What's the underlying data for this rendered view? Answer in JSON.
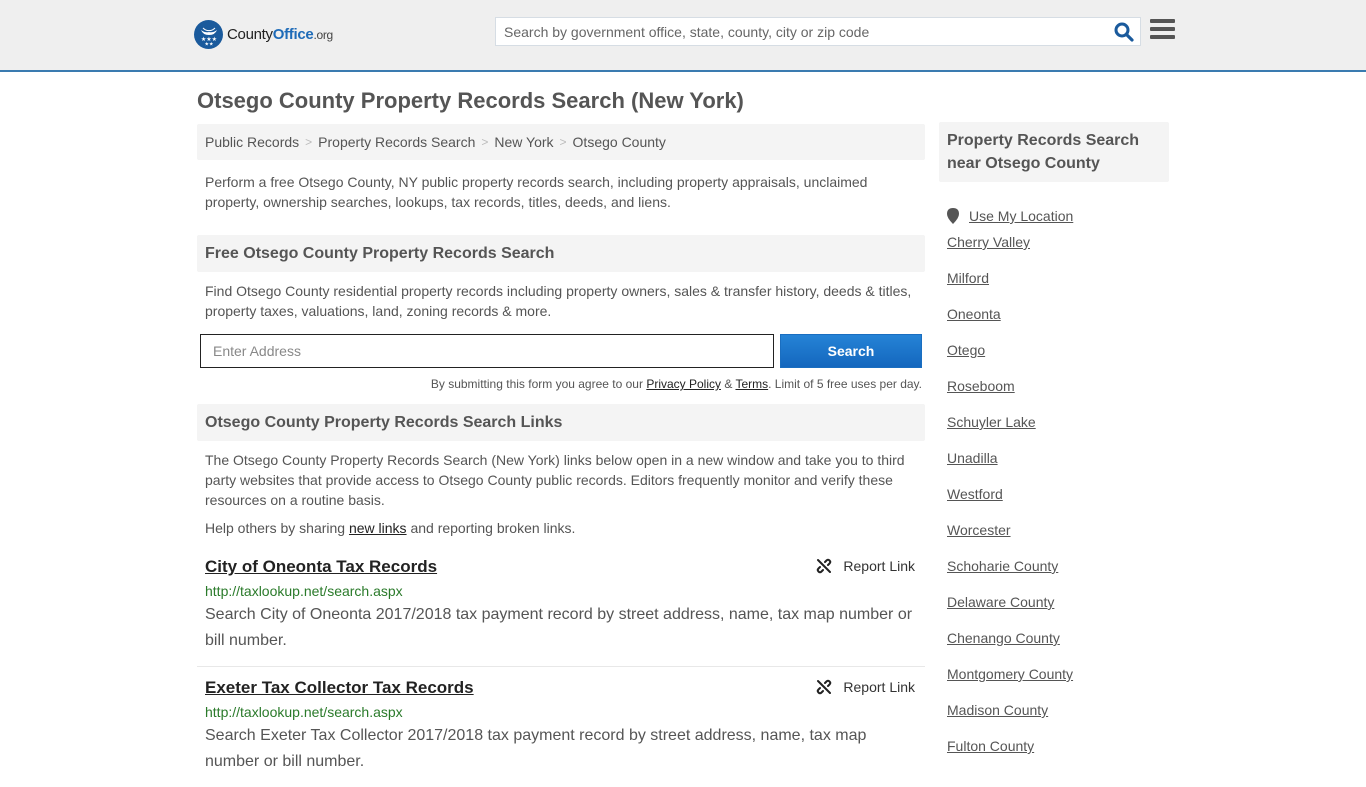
{
  "header": {
    "logo": {
      "name": "County",
      "name_accent": "Office",
      "tld": ".org"
    },
    "search_placeholder": "Search by government office, state, county, city or zip code",
    "search_icon": "search-icon",
    "menu_icon": "hamburger-menu-icon"
  },
  "page_title": "Otsego County Property Records Search (New York)",
  "breadcrumb": [
    {
      "label": "Public Records"
    },
    {
      "label": "Property Records Search"
    },
    {
      "label": "New York"
    },
    {
      "label": "Otsego County"
    }
  ],
  "intro": "Perform a free Otsego County, NY public property records search, including property appraisals, unclaimed property, ownership searches, lookups, tax records, titles, deeds, and liens.",
  "search_section": {
    "heading": "Free Otsego County Property Records Search",
    "description": "Find Otsego County residential property records including property owners, sales & transfer history, deeds & titles, property taxes, valuations, land, zoning records & more.",
    "address_placeholder": "Enter Address",
    "button_label": "Search",
    "terms_prefix": "By submitting this form you agree to our ",
    "privacy_label": "Privacy Policy",
    "terms_amp": " & ",
    "terms_label": "Terms",
    "terms_suffix": ". Limit of 5 free uses per day."
  },
  "links_section": {
    "heading": "Otsego County Property Records Search Links",
    "description": "The Otsego County Property Records Search (New York) links below open in a new window and take you to third party websites that provide access to Otsego County public records. Editors frequently monitor and verify these resources on a routine basis.",
    "help_prefix": "Help others by sharing ",
    "help_link": "new links",
    "help_suffix": " and reporting broken links.",
    "report_label": "Report Link",
    "items": [
      {
        "title": "City of Oneonta Tax Records",
        "url": "http://taxlookup.net/search.aspx",
        "description": "Search City of Oneonta 2017/2018 tax payment record by street address, name, tax map number or bill number."
      },
      {
        "title": "Exeter Tax Collector Tax Records",
        "url": "http://taxlookup.net/search.aspx",
        "description": "Search Exeter Tax Collector 2017/2018 tax payment record by street address, name, tax map number or bill number."
      }
    ]
  },
  "sidebar": {
    "heading": "Property Records Search near Otsego County",
    "use_location": "Use My Location",
    "items": [
      "Cherry Valley",
      "Milford",
      "Oneonta",
      "Otego",
      "Roseboom",
      "Schuyler Lake",
      "Unadilla",
      "Westford",
      "Worcester",
      "Schoharie County",
      "Delaware County",
      "Chenango County",
      "Montgomery County",
      "Madison County",
      "Fulton County"
    ]
  },
  "colors": {
    "accent_blue": "#1e6bb8",
    "header_border": "#3a7bb0",
    "url_green": "#2a7a2a",
    "button_blue": "#1a6ec0"
  }
}
